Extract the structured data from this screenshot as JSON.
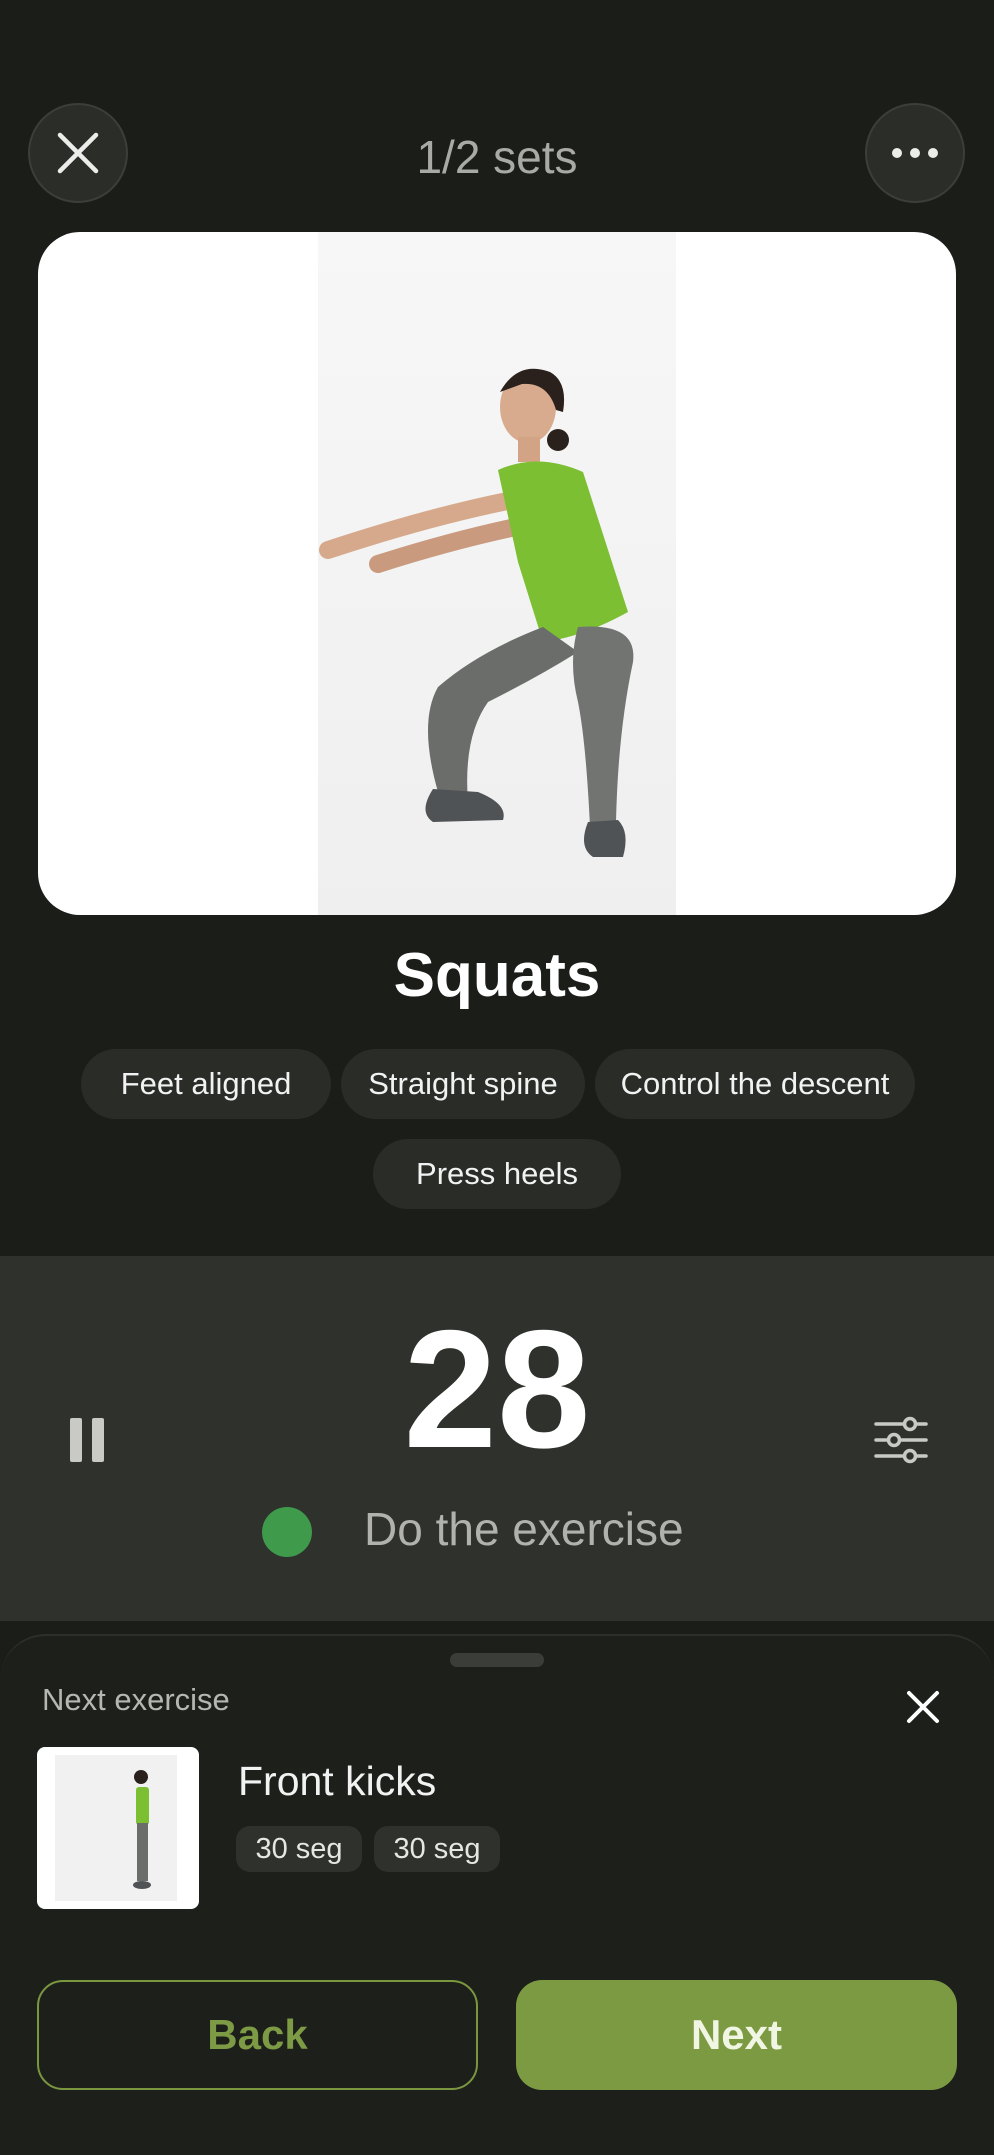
{
  "header": {
    "sets_label": "1/2 sets"
  },
  "exercise": {
    "title": "Squats",
    "tips": [
      "Feet aligned",
      "Straight spine",
      "Control the descent",
      "Press heels"
    ]
  },
  "timer": {
    "count": "28",
    "status": "Do the exercise"
  },
  "next_sheet": {
    "label": "Next exercise",
    "name": "Front kicks",
    "tags": [
      "30 seg",
      "30 seg"
    ]
  },
  "actions": {
    "back_label": "Back",
    "next_label": "Next"
  },
  "colors": {
    "background": "#1b1d19",
    "accent_green": "#7b9a41",
    "status_dot": "#3f9a4c",
    "shirt_green": "#7cbf33"
  }
}
